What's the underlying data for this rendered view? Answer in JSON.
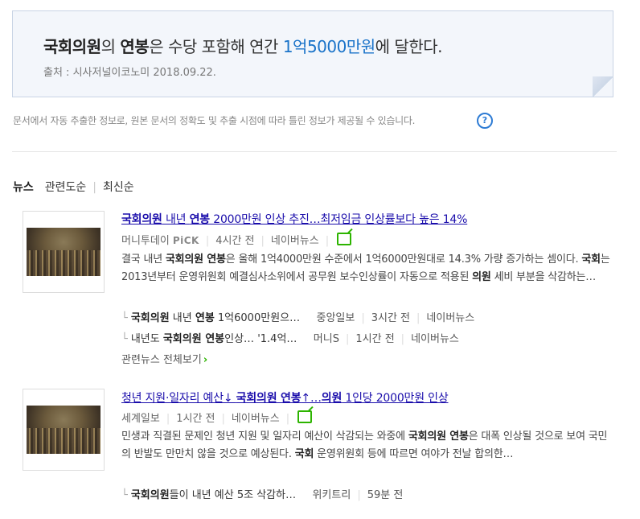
{
  "answer": {
    "term1": "국회의원",
    "particle1": "의 ",
    "term2": "연봉",
    "middle": "은 수당 포함해 연간 ",
    "value": "1억5000만원",
    "end": "에 달한다.",
    "source": "출처 : 시사저널이코노미 2018.09.22."
  },
  "disclaimer": "문서에서 자동 추출한 정보로, 원본 문서의 정확도 및 추출 시점에 따라 틀린 정보가 제공될 수 있습니다.",
  "help_icon": "question-circle-icon",
  "tabs": {
    "news": "뉴스",
    "relevance": "관련도순",
    "recent": "최신순"
  },
  "news": [
    {
      "title_parts": [
        "국회의원",
        " 내년 ",
        "연봉",
        " 2000만원 인상 추진…최저임금 인상률보다 높은 14%"
      ],
      "press": "머니투데이",
      "pick": "PiCK",
      "time": "4시간 전",
      "portal": "네이버뉴스",
      "desc_parts": [
        "결국 내년 ",
        "국회의원 연봉",
        "은 올해 1억4000만원 수준에서 1억6000만원대로 14.3% 가량 증가하는 셈이다. ",
        "국회",
        "는 2013년부터 운영위원회 예결심사소위에서 공무원 보수인상률이 자동으로 적용된 ",
        "의원",
        " 세비 부분을 삭감하는…"
      ],
      "related": [
        {
          "parts": [
            "국회의원",
            " 내년 ",
            "연봉",
            " 1억6000만원으…"
          ],
          "press": "중앙일보",
          "time": "3시간 전",
          "portal": "네이버뉴스"
        },
        {
          "parts": [
            "내년도 ",
            "국회의원 연봉",
            "인상… '1.4억…"
          ],
          "press": "머니S",
          "time": "1시간 전",
          "portal": "네이버뉴스"
        }
      ],
      "more": "관련뉴스 전체보기"
    },
    {
      "title_parts": [
        "청년 지원·일자리 예산↓ ",
        "국회의원 연봉",
        "↑…",
        "의원",
        " 1인당 2000만원 인상"
      ],
      "press": "세계일보",
      "time": "1시간 전",
      "portal": "네이버뉴스",
      "desc_parts": [
        "민생과 직결된 문제인 청년 지원 및 일자리 예산이 삭감되는 와중에 ",
        "국회의원 연봉",
        "은 대폭 인상될 것으로 보여 국민의 반발도 만만치 않을 것으로 예상된다. ",
        "국회",
        " 운영위원회 등에 따르면 여야가 전날 합의한…"
      ],
      "related": [
        {
          "parts": [
            "국회의원",
            "들이 내년 예산 5조 삭감하…"
          ],
          "press": "위키트리",
          "time": "59분 전"
        }
      ]
    }
  ],
  "colors": {
    "highlight": "#1a73c9",
    "link": "#1a0dab",
    "naver_green": "#2db400"
  }
}
